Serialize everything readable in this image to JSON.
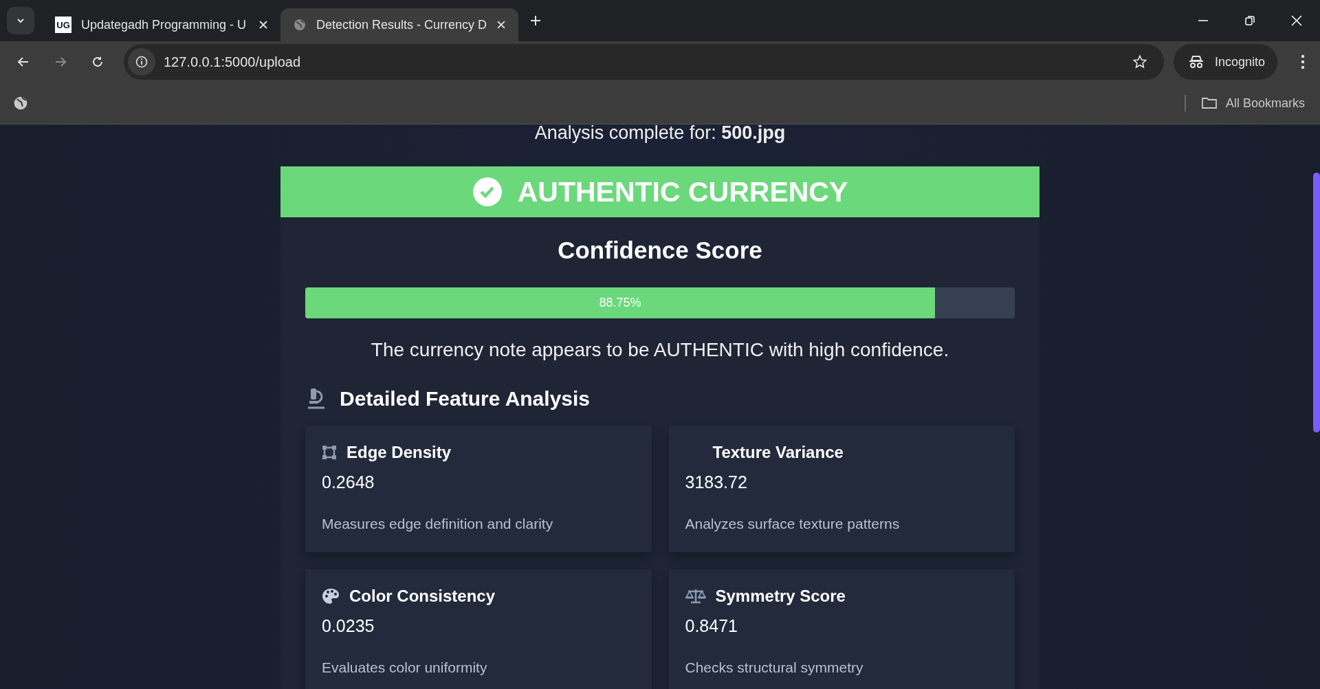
{
  "browser": {
    "tabs": [
      {
        "title": "Updategadh Programming - U",
        "kind": "logo",
        "selected": false
      },
      {
        "title": "Detection Results - Currency D",
        "kind": "globe",
        "selected": true
      }
    ],
    "logo_text": "UG",
    "address": "127.0.0.1:5000/upload",
    "profile": "Incognito",
    "bookmarks_label": "All Bookmarks"
  },
  "page": {
    "subtitle": "Analysis complete for: **500.jpg**",
    "verdict": {
      "label": "AUTHENTIC CURRENCY",
      "authentic": true
    },
    "confidence": {
      "title": "Confidence Score",
      "level": 0.8875,
      "reading": "88.75%"
    },
    "message": "The currency note appears to be AUTHENTIC with high confidence.",
    "features_title": "Detailed Feature Analysis",
    "features": [
      {
        "kind": "edge",
        "name": "Edge Density",
        "value": "0.2648",
        "description": "Measures edge definition and clarity"
      },
      {
        "kind": "none",
        "name": "Texture Variance",
        "value": "3183.72",
        "description": "Analyzes surface texture patterns"
      },
      {
        "kind": "color",
        "name": "Color Consistency",
        "value": "0.0235",
        "description": "Evaluates color uniformity"
      },
      {
        "kind": "symmetry",
        "name": "Symmetry Score",
        "value": "0.8471",
        "description": "Checks structural symmetry"
      }
    ]
  }
}
